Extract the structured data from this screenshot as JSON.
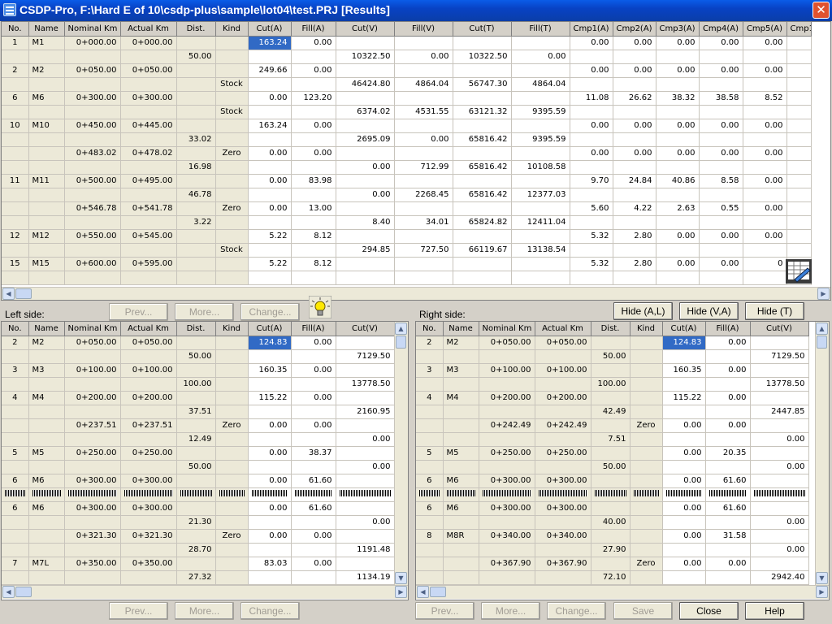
{
  "window": {
    "title": "CSDP-Pro, F:\\Hard E of 10\\csdp-plus\\sample\\lot04\\test.PRJ [Results]",
    "close_glyph": "✕"
  },
  "top_grid": {
    "columns": [
      "No.",
      "Name",
      "Nominal Km",
      "Actual Km",
      "Dist.",
      "Kind",
      "Cut(A)",
      "Fill(A)",
      "Cut(V)",
      "Fill(V)",
      "Cut(T)",
      "Fill(T)",
      "Cmp1(A)",
      "Cmp2(A)",
      "Cmp3(A)",
      "Cmp4(A)",
      "Cmp5(A)",
      "Cmp1"
    ],
    "rows": [
      [
        "1",
        "M1",
        "0+000.00",
        "0+000.00",
        "",
        "",
        "163.24",
        "0.00",
        "",
        "",
        "",
        "",
        "0.00",
        "0.00",
        "0.00",
        "0.00",
        "0.00",
        ""
      ],
      [
        "",
        "",
        "",
        "",
        "50.00",
        "",
        "",
        "",
        "10322.50",
        "0.00",
        "10322.50",
        "0.00",
        "",
        "",
        "",
        "",
        "",
        ""
      ],
      [
        "2",
        "M2",
        "0+050.00",
        "0+050.00",
        "",
        "",
        "249.66",
        "0.00",
        "",
        "",
        "",
        "",
        "0.00",
        "0.00",
        "0.00",
        "0.00",
        "0.00",
        ""
      ],
      [
        "",
        "",
        "",
        "",
        "",
        "Stock",
        "",
        "",
        "46424.80",
        "4864.04",
        "56747.30",
        "4864.04",
        "",
        "",
        "",
        "",
        "",
        ""
      ],
      [
        "6",
        "M6",
        "0+300.00",
        "0+300.00",
        "",
        "",
        "0.00",
        "123.20",
        "",
        "",
        "",
        "",
        "11.08",
        "26.62",
        "38.32",
        "38.58",
        "8.52",
        ""
      ],
      [
        "",
        "",
        "",
        "",
        "",
        "Stock",
        "",
        "",
        "6374.02",
        "4531.55",
        "63121.32",
        "9395.59",
        "",
        "",
        "",
        "",
        "",
        ""
      ],
      [
        "10",
        "M10",
        "0+450.00",
        "0+445.00",
        "",
        "",
        "163.24",
        "0.00",
        "",
        "",
        "",
        "",
        "0.00",
        "0.00",
        "0.00",
        "0.00",
        "0.00",
        ""
      ],
      [
        "",
        "",
        "",
        "",
        "33.02",
        "",
        "",
        "",
        "2695.09",
        "0.00",
        "65816.42",
        "9395.59",
        "",
        "",
        "",
        "",
        "",
        ""
      ],
      [
        "",
        "",
        "0+483.02",
        "0+478.02",
        "",
        "Zero",
        "0.00",
        "0.00",
        "",
        "",
        "",
        "",
        "0.00",
        "0.00",
        "0.00",
        "0.00",
        "0.00",
        ""
      ],
      [
        "",
        "",
        "",
        "",
        "16.98",
        "",
        "",
        "",
        "0.00",
        "712.99",
        "65816.42",
        "10108.58",
        "",
        "",
        "",
        "",
        "",
        ""
      ],
      [
        "11",
        "M11",
        "0+500.00",
        "0+495.00",
        "",
        "",
        "0.00",
        "83.98",
        "",
        "",
        "",
        "",
        "9.70",
        "24.84",
        "40.86",
        "8.58",
        "0.00",
        ""
      ],
      [
        "",
        "",
        "",
        "",
        "46.78",
        "",
        "",
        "",
        "0.00",
        "2268.45",
        "65816.42",
        "12377.03",
        "",
        "",
        "",
        "",
        "",
        ""
      ],
      [
        "",
        "",
        "0+546.78",
        "0+541.78",
        "",
        "Zero",
        "0.00",
        "13.00",
        "",
        "",
        "",
        "",
        "5.60",
        "4.22",
        "2.63",
        "0.55",
        "0.00",
        ""
      ],
      [
        "",
        "",
        "",
        "",
        "3.22",
        "",
        "",
        "",
        "8.40",
        "34.01",
        "65824.82",
        "12411.04",
        "",
        "",
        "",
        "",
        "",
        ""
      ],
      [
        "12",
        "M12",
        "0+550.00",
        "0+545.00",
        "",
        "",
        "5.22",
        "8.12",
        "",
        "",
        "",
        "",
        "5.32",
        "2.80",
        "0.00",
        "0.00",
        "0.00",
        ""
      ],
      [
        "",
        "",
        "",
        "",
        "",
        "Stock",
        "",
        "",
        "294.85",
        "727.50",
        "66119.67",
        "13138.54",
        "",
        "",
        "",
        "",
        "",
        ""
      ],
      [
        "15",
        "M15",
        "0+600.00",
        "0+595.00",
        "",
        "",
        "5.22",
        "8.12",
        "",
        "",
        "",
        "",
        "5.32",
        "2.80",
        "0.00",
        "0.00",
        "0",
        ""
      ],
      [
        "",
        "",
        "",
        "",
        "",
        "",
        "",
        "",
        "",
        "",
        "",
        "",
        "",
        "",
        "",
        "",
        "",
        ""
      ]
    ]
  },
  "top_buttons": {
    "prev": "Prev...",
    "more": "More...",
    "change": "Change...",
    "hide_al": "Hide (A,L)",
    "hide_va": "Hide (V,A)",
    "hide_t": "Hide (T)"
  },
  "left_panel": {
    "label": "Left side:",
    "columns": [
      "No.",
      "Name",
      "Nominal Km",
      "Actual Km",
      "Dist.",
      "Kind",
      "Cut(A)",
      "Fill(A)",
      "Cut(V)"
    ],
    "rows": [
      [
        "2",
        "M2",
        "0+050.00",
        "0+050.00",
        "",
        "",
        "124.83",
        "0.00",
        ""
      ],
      [
        "",
        "",
        "",
        "",
        "50.00",
        "",
        "",
        "",
        "7129.50"
      ],
      [
        "3",
        "M3",
        "0+100.00",
        "0+100.00",
        "",
        "",
        "160.35",
        "0.00",
        ""
      ],
      [
        "",
        "",
        "",
        "",
        "100.00",
        "",
        "",
        "",
        "13778.50"
      ],
      [
        "4",
        "M4",
        "0+200.00",
        "0+200.00",
        "",
        "",
        "115.22",
        "0.00",
        ""
      ],
      [
        "",
        "",
        "",
        "",
        "37.51",
        "",
        "",
        "",
        "2160.95"
      ],
      [
        "",
        "",
        "0+237.51",
        "0+237.51",
        "",
        "Zero",
        "0.00",
        "0.00",
        ""
      ],
      [
        "",
        "",
        "",
        "",
        "12.49",
        "",
        "",
        "",
        "0.00"
      ],
      [
        "5",
        "M5",
        "0+250.00",
        "0+250.00",
        "",
        "",
        "0.00",
        "38.37",
        ""
      ],
      [
        "",
        "",
        "",
        "",
        "50.00",
        "",
        "",
        "",
        "0.00"
      ],
      [
        "6",
        "M6",
        "0+300.00",
        "0+300.00",
        "",
        "",
        "0.00",
        "61.60",
        ""
      ],
      [
        "#",
        "#",
        "#",
        "#",
        "#",
        "#",
        "#",
        "#",
        "#"
      ],
      [
        "6",
        "M6",
        "0+300.00",
        "0+300.00",
        "",
        "",
        "0.00",
        "61.60",
        ""
      ],
      [
        "",
        "",
        "",
        "",
        "21.30",
        "",
        "",
        "",
        "0.00"
      ],
      [
        "",
        "",
        "0+321.30",
        "0+321.30",
        "",
        "Zero",
        "0.00",
        "0.00",
        ""
      ],
      [
        "",
        "",
        "",
        "",
        "28.70",
        "",
        "",
        "",
        "1191.48"
      ],
      [
        "7",
        "M7L",
        "0+350.00",
        "0+350.00",
        "",
        "",
        "83.03",
        "0.00",
        ""
      ],
      [
        "",
        "",
        "",
        "",
        "27.32",
        "",
        "",
        "",
        "1134.19"
      ]
    ]
  },
  "right_panel": {
    "label": "Right side:",
    "columns": [
      "No.",
      "Name",
      "Nominal Km",
      "Actual Km",
      "Dist.",
      "Kind",
      "Cut(A)",
      "Fill(A)",
      "Cut(V)"
    ],
    "rows": [
      [
        "2",
        "M2",
        "0+050.00",
        "0+050.00",
        "",
        "",
        "124.83",
        "0.00",
        ""
      ],
      [
        "",
        "",
        "",
        "",
        "50.00",
        "",
        "",
        "",
        "7129.50"
      ],
      [
        "3",
        "M3",
        "0+100.00",
        "0+100.00",
        "",
        "",
        "160.35",
        "0.00",
        ""
      ],
      [
        "",
        "",
        "",
        "",
        "100.00",
        "",
        "",
        "",
        "13778.50"
      ],
      [
        "4",
        "M4",
        "0+200.00",
        "0+200.00",
        "",
        "",
        "115.22",
        "0.00",
        ""
      ],
      [
        "",
        "",
        "",
        "",
        "42.49",
        "",
        "",
        "",
        "2447.85"
      ],
      [
        "",
        "",
        "0+242.49",
        "0+242.49",
        "",
        "Zero",
        "0.00",
        "0.00",
        ""
      ],
      [
        "",
        "",
        "",
        "",
        "7.51",
        "",
        "",
        "",
        "0.00"
      ],
      [
        "5",
        "M5",
        "0+250.00",
        "0+250.00",
        "",
        "",
        "0.00",
        "20.35",
        ""
      ],
      [
        "",
        "",
        "",
        "",
        "50.00",
        "",
        "",
        "",
        "0.00"
      ],
      [
        "6",
        "M6",
        "0+300.00",
        "0+300.00",
        "",
        "",
        "0.00",
        "61.60",
        ""
      ],
      [
        "#",
        "#",
        "#",
        "#",
        "#",
        "#",
        "#",
        "#",
        "#"
      ],
      [
        "6",
        "M6",
        "0+300.00",
        "0+300.00",
        "",
        "",
        "0.00",
        "61.60",
        ""
      ],
      [
        "",
        "",
        "",
        "",
        "40.00",
        "",
        "",
        "",
        "0.00"
      ],
      [
        "8",
        "M8R",
        "0+340.00",
        "0+340.00",
        "",
        "",
        "0.00",
        "31.58",
        ""
      ],
      [
        "",
        "",
        "",
        "",
        "27.90",
        "",
        "",
        "",
        "0.00"
      ],
      [
        "",
        "",
        "0+367.90",
        "0+367.90",
        "",
        "Zero",
        "0.00",
        "0.00",
        ""
      ],
      [
        "",
        "",
        "",
        "",
        "72.10",
        "",
        "",
        "",
        "2942.40"
      ]
    ]
  },
  "bottom_buttons": {
    "left_prev": "Prev...",
    "left_more": "More...",
    "left_change": "Change...",
    "right_prev": "Prev...",
    "right_more": "More...",
    "right_change": "Change...",
    "save": "Save",
    "close": "Close",
    "help": "Help"
  },
  "icons": {
    "titlebar": "app-icon",
    "bulb": "lightbulb-icon",
    "sheet": "spreadsheet-edit-icon"
  },
  "colors": {
    "selection": "#316ac5",
    "fixed_cell": "#ece9d8",
    "titlebar": "#0a5ce8"
  }
}
